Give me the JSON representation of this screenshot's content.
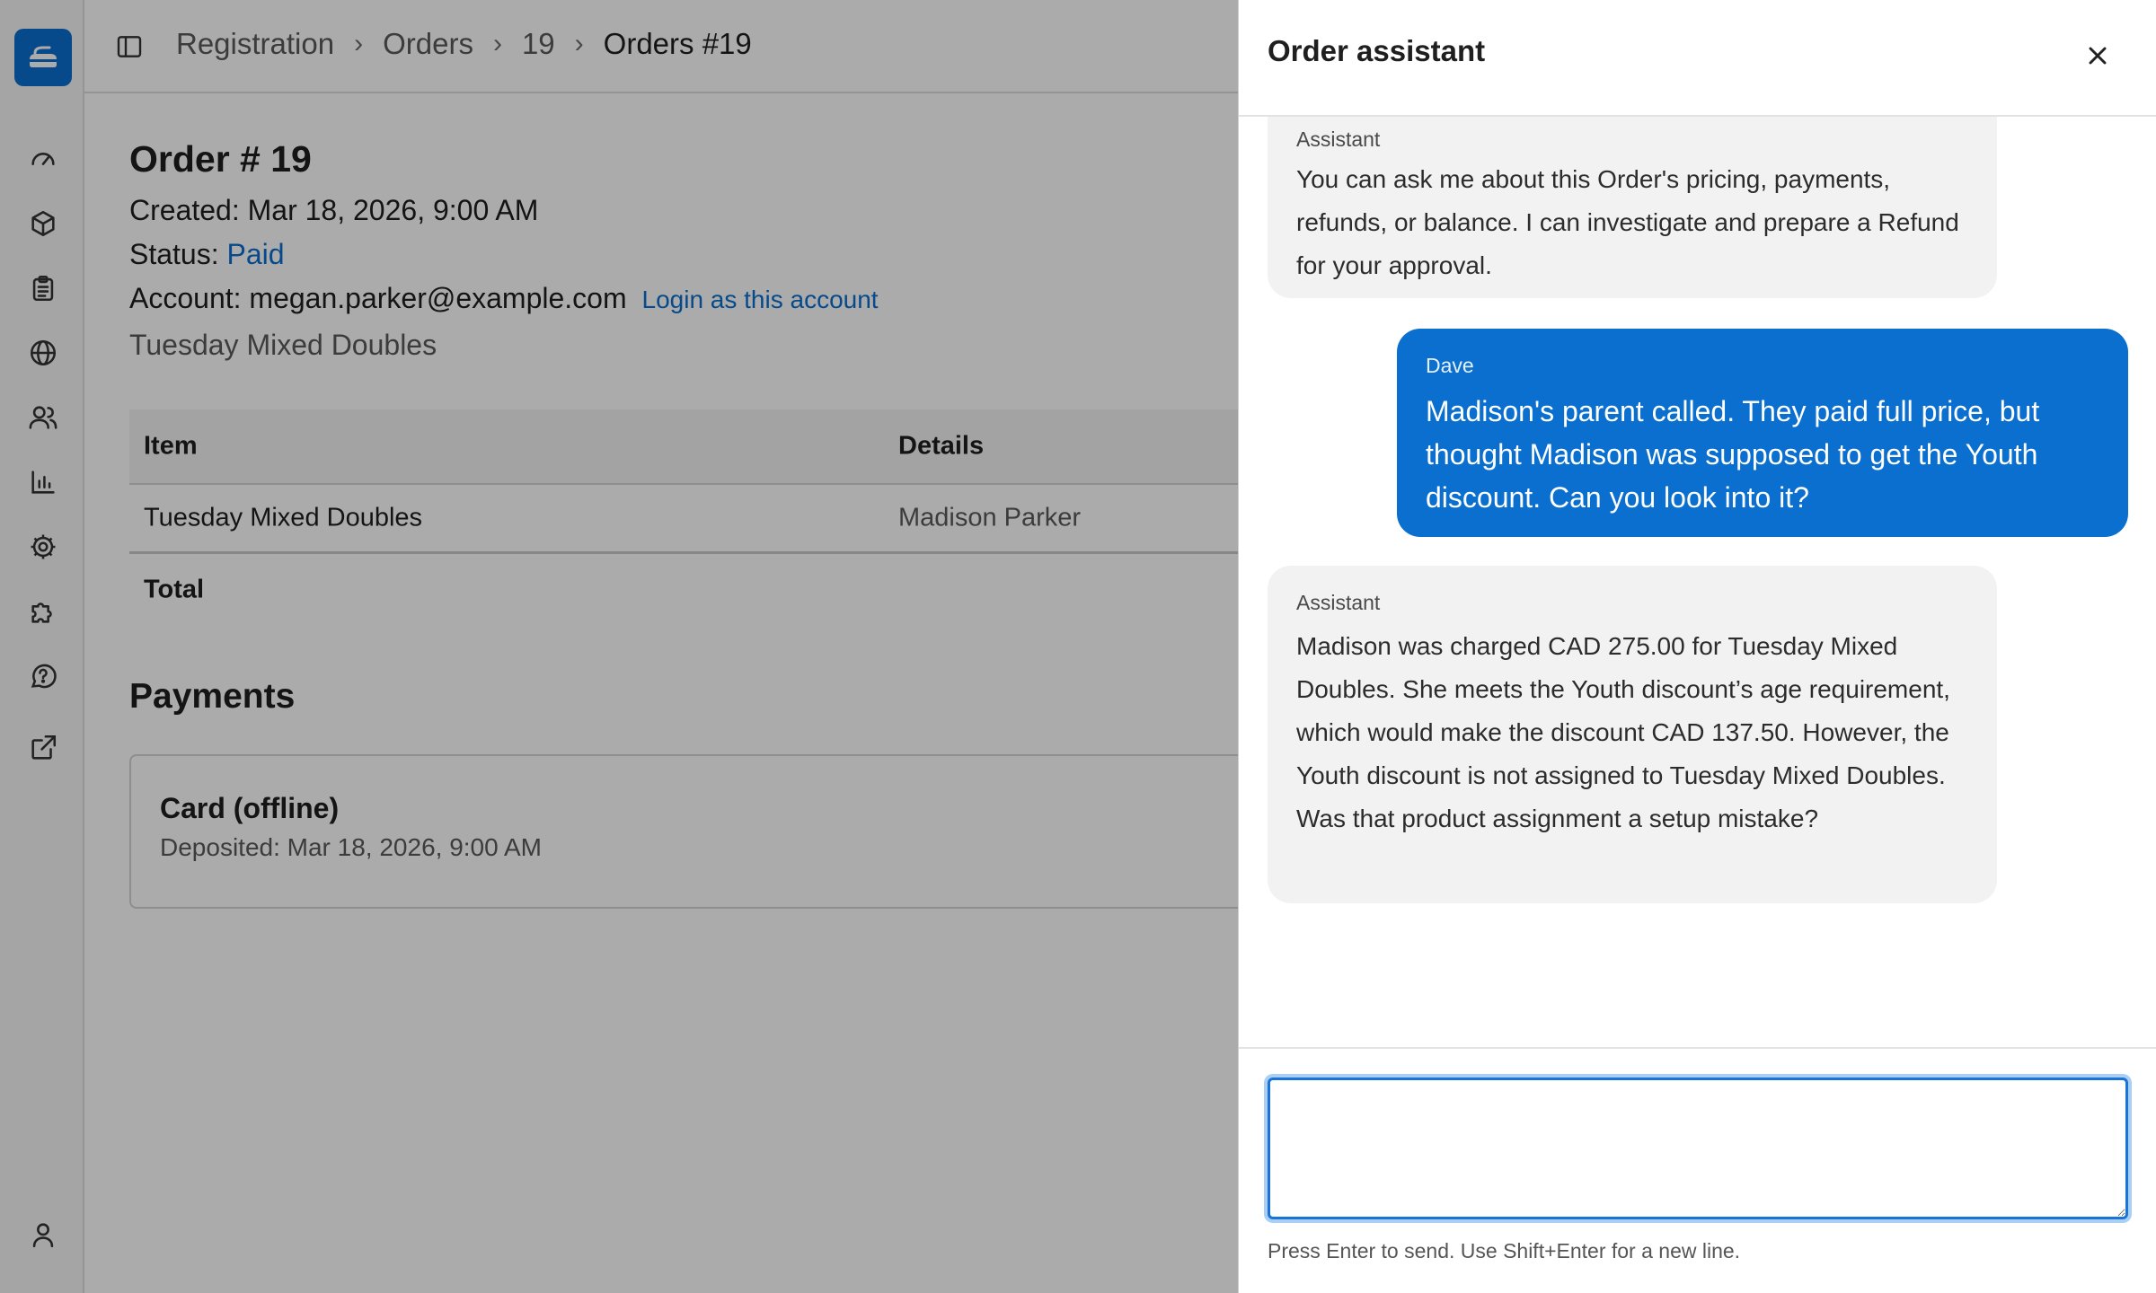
{
  "sidebar": {
    "logo_icon": "curling-stone-icon",
    "items": [
      {
        "icon": "dashboard-gauge-icon"
      },
      {
        "icon": "box-icon"
      },
      {
        "icon": "clipboard-icon"
      },
      {
        "icon": "globe-icon"
      },
      {
        "icon": "users-icon"
      },
      {
        "icon": "bar-chart-icon"
      },
      {
        "icon": "gear-icon"
      },
      {
        "icon": "puzzle-icon"
      },
      {
        "icon": "help-circle-icon"
      },
      {
        "icon": "external-link-icon"
      }
    ],
    "bottom_icon": "user-icon"
  },
  "breadcrumb": {
    "items": [
      "Registration",
      "Orders",
      "19"
    ],
    "current": "Orders #19",
    "separator": "›"
  },
  "order": {
    "title": "Order # 19",
    "created_label": "Created:",
    "created_value": "Mar 18, 2026, 9:00 AM",
    "status_label": "Status:",
    "status_value": "Paid",
    "account_label": "Account:",
    "account_value": "megan.parker@example.com",
    "login_link": "Login as this account",
    "description": "Tuesday Mixed Doubles"
  },
  "items_table": {
    "headers": [
      "Item",
      "Details"
    ],
    "rows": [
      [
        "Tuesday Mixed Doubles",
        "Madison Parker"
      ]
    ],
    "total_label": "Total"
  },
  "payments": {
    "heading": "Payments",
    "card": {
      "method": "Card (offline)",
      "deposited_label": "Deposited:",
      "deposited_value": "Mar 18, 2026, 9:00 AM"
    }
  },
  "drawer": {
    "title": "Order assistant",
    "close_icon": "close-icon",
    "messages": [
      {
        "role": "assistant",
        "sender": "Assistant",
        "text": "You can ask me about this Order's pricing, payments, refunds, or balance. I can investigate and prepare a Refund for your approval."
      },
      {
        "role": "user",
        "sender": "Dave",
        "text": "Madison's parent called. They paid full price, but thought Madison was supposed to get the Youth discount. Can you look into it?"
      },
      {
        "role": "assistant",
        "sender": "Assistant",
        "text": "Madison was charged CAD 275.00 for Tuesday Mixed Doubles. She meets the Youth discount’s age requirement, which would make the discount CAD 137.50. However, the Youth discount is not assigned to Tuesday Mixed Doubles. Was that product assignment a setup mistake?"
      }
    ],
    "composer": {
      "value": "",
      "placeholder": "",
      "hint": "Press Enter to send. Use Shift+Enter for a new line."
    }
  },
  "colors": {
    "accent": "#0b6fd0",
    "overlay": "rgba(0,0,0,0.33)",
    "assistant_bubble": "#f2f2f2",
    "user_bubble": "#0b6fd0"
  }
}
